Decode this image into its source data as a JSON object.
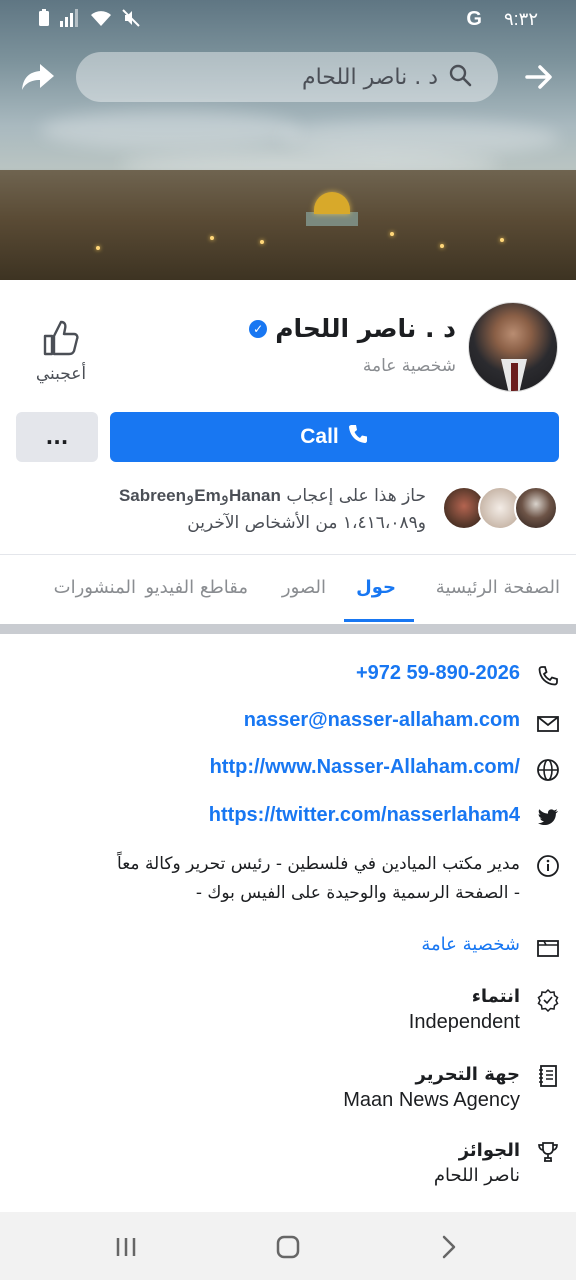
{
  "status_bar": {
    "time": "٩:٣٢",
    "g_label": "G"
  },
  "search": {
    "text": "د . ناصر اللحام"
  },
  "profile": {
    "name": "د . ناصر اللحام",
    "category": "شخصية عامة",
    "like_label": "أعجبني",
    "call_label": "Call",
    "more_label": "...",
    "friends_line1_prefix": "حاز هذا على إعجاب",
    "friends_names": [
      "Hanan",
      "Em",
      "Sabreen"
    ],
    "friends_line2": "و١،٤١٦،٠٨٩ من الأشخاص الآخرين"
  },
  "tabs": [
    {
      "label": "الصفحة الرئيسية",
      "active": false
    },
    {
      "label": "حول",
      "active": true
    },
    {
      "label": "الصور",
      "active": false
    },
    {
      "label": "مقاطع الفيديو",
      "active": false
    },
    {
      "label": "المنشورات",
      "active": false
    }
  ],
  "about": {
    "phone": "+972 59-890-2026",
    "email": "nasser@nasser-allaham.com",
    "website": "http://www.Nasser-Allaham.com/",
    "twitter": "https://twitter.com/nasserlaham4",
    "bio_line1": "مدير مكتب الميادين في فلسطين - رئيس تحرير وكالة معاً",
    "bio_line2": "- الصفحة الرسمية والوحيدة على الفيس بوك -",
    "page_category": "شخصية عامة",
    "affiliation_label": "انتماء",
    "affiliation_value": "Independent",
    "editor_label": "جهة التحرير",
    "editor_value": "Maan News Agency",
    "awards_label": "الجوائز",
    "awards_value": "ناصر اللحام"
  },
  "colors": {
    "accent": "#1877f2",
    "muted_bg": "#e4e6eb"
  }
}
